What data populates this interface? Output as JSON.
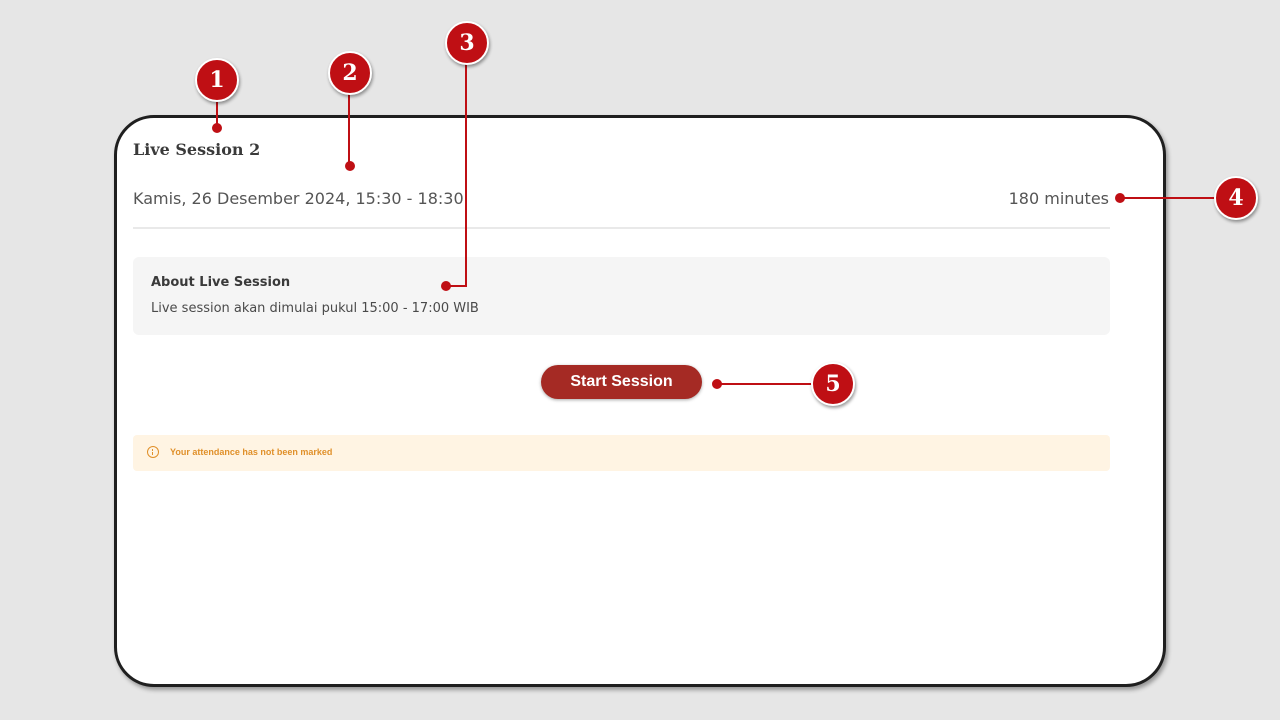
{
  "session": {
    "title": "Live Session 2",
    "date_time": "Kamis, 26 Desember 2024, 15:30 - 18:30",
    "duration": "180 minutes"
  },
  "about": {
    "heading": "About Live Session",
    "description": "Live session akan dimulai pukul 15:00 - 17:00 WIB"
  },
  "actions": {
    "start_label": "Start Session"
  },
  "attendance": {
    "message": "Your attendance has not been marked",
    "icon": "info-circle-icon"
  },
  "callouts": [
    "1",
    "2",
    "3",
    "4",
    "5"
  ],
  "colors": {
    "accent": "#a52a24",
    "callout": "#bf0f14",
    "warning": "#e0902a",
    "warning_bg": "#fff4e3"
  }
}
